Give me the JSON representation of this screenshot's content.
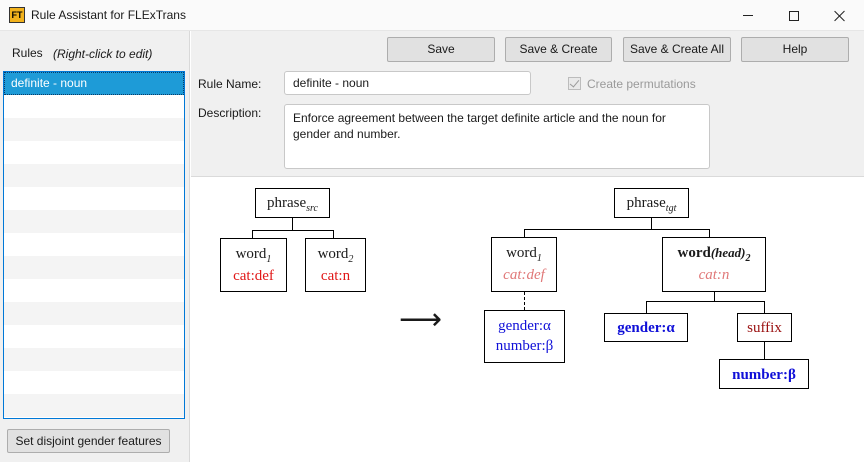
{
  "window": {
    "title": "Rule Assistant for FLExTrans",
    "icon_text": "FT"
  },
  "sidebar": {
    "rules_label": "Rules",
    "rules_hint": "(Right-click to edit)",
    "items": [
      {
        "label": "definite - noun"
      }
    ],
    "disjoint_button": "Set disjoint gender features"
  },
  "toolbar": {
    "save": "Save",
    "save_create": "Save & Create",
    "save_create_all": "Save & Create All",
    "help": "Help"
  },
  "form": {
    "name_label": "Rule Name:",
    "name_value": "definite - noun",
    "permutations_label": "Create permutations",
    "permutations_checked": true,
    "description_label": "Description:",
    "description_value": "Enforce agreement between the target definite article and the noun for gender and number."
  },
  "tree": {
    "src": {
      "phrase": "phrase",
      "phrase_sub": "src",
      "word1": "word",
      "word1_sub": "1",
      "word1_feat": "cat:def",
      "word2": "word",
      "word2_sub": "2",
      "word2_feat": "cat:n"
    },
    "arrow": "⟶",
    "tgt": {
      "phrase": "phrase",
      "phrase_sub": "tgt",
      "word1": "word",
      "word1_sub": "1",
      "word1_feat": "cat:def",
      "word1_gender": "gender:α",
      "word1_number": "number:β",
      "head_word": "word",
      "head_paren": "(head)",
      "head_sub": "2",
      "head_feat": "cat:n",
      "head_gender": "gender:α",
      "suffix": "suffix",
      "suffix_number": "number:β"
    }
  },
  "colors": {
    "selected_row": "#1e9bd7",
    "feature_red": "#e11818",
    "feature_blue": "#1010d8",
    "suffix_red": "#9a1010"
  }
}
